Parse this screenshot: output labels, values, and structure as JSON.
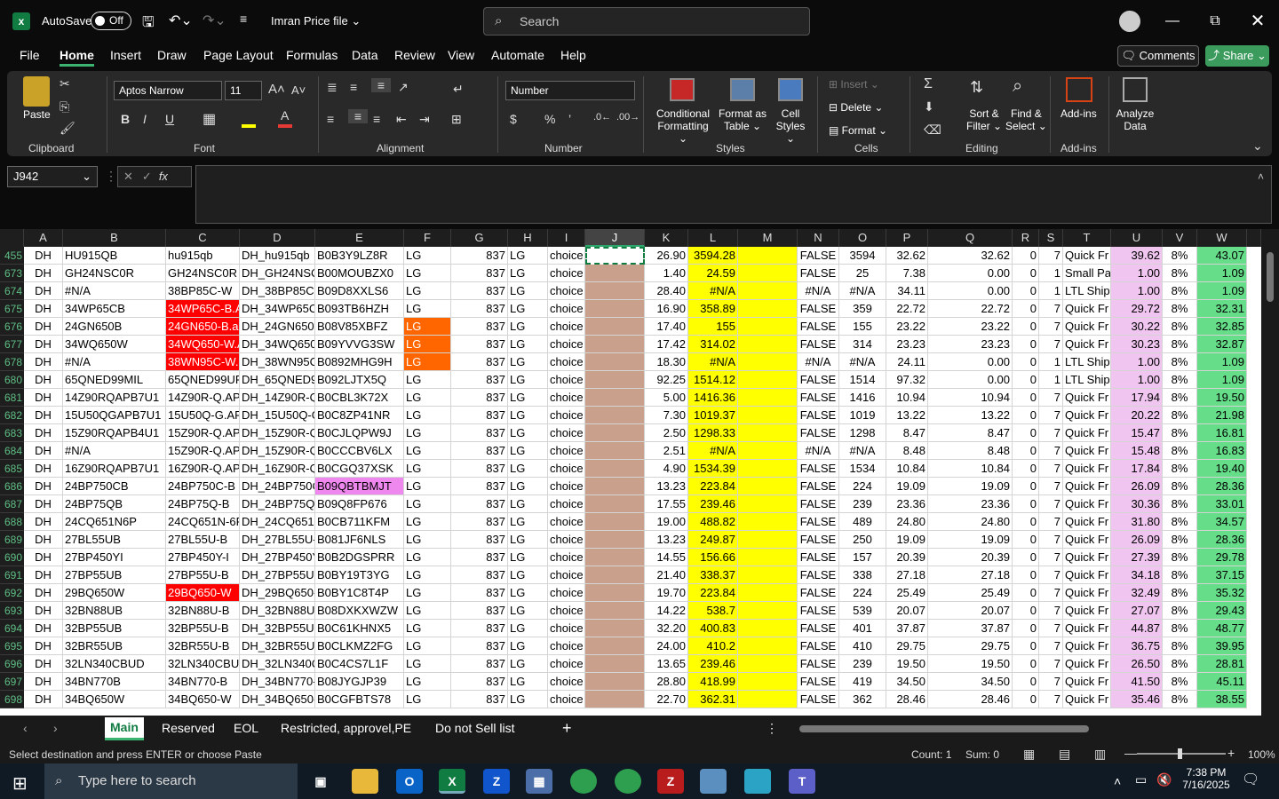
{
  "titlebar": {
    "autosave_label": "AutoSave",
    "toggle_state": "Off",
    "file_name": "Imran Price file",
    "search_placeholder": "Search"
  },
  "menu": [
    "File",
    "Home",
    "Insert",
    "Draw",
    "Page Layout",
    "Formulas",
    "Data",
    "Review",
    "View",
    "Automate",
    "Help"
  ],
  "menu_active": "Home",
  "comments_label": "Comments",
  "share_label": "Share",
  "ribbon": {
    "paste": "Paste",
    "clipboard": "Clipboard",
    "font_name": "Aptos Narrow",
    "font_size": "11",
    "font": "Font",
    "alignment": "Alignment",
    "number_format": "Number",
    "number": "Number",
    "cond_fmt_1": "Conditional",
    "cond_fmt_2": "Formatting",
    "fmt_table_1": "Format as",
    "fmt_table_2": "Table",
    "cell_styles_1": "Cell",
    "cell_styles_2": "Styles",
    "styles": "Styles",
    "insert": "Insert",
    "delete": "Delete",
    "format": "Format",
    "cells": "Cells",
    "sort_1": "Sort &",
    "sort_2": "Filter",
    "find_1": "Find &",
    "find_2": "Select",
    "editing": "Editing",
    "addins": "Add-ins",
    "analyze_1": "Analyze",
    "analyze_2": "Data",
    "bold": "B",
    "italic": "I",
    "underline": "U"
  },
  "name_box": "J942",
  "fx": "fx",
  "columns": [
    "A",
    "B",
    "C",
    "D",
    "E",
    "F",
    "G",
    "H",
    "I",
    "J",
    "K",
    "L",
    "M",
    "N",
    "O",
    "P",
    "Q",
    "R",
    "S",
    "T",
    "U",
    "V",
    "W"
  ],
  "rows": [
    {
      "n": "455",
      "A": "DH",
      "B": "HU915QB",
      "C": "hu915qb",
      "D": "DH_hu915qb",
      "E": "B0B3Y9LZ8R",
      "F": "LG",
      "G": "837",
      "H": "LG",
      "I": "choice",
      "K": "26.90",
      "L": "3594.28",
      "N": "FALSE",
      "O": "3594",
      "P": "32.62",
      "Q": "32.62",
      "R": "0",
      "S": "7",
      "T": "Quick Fr",
      "U": "39.62",
      "V": "8%",
      "W": "43.07"
    },
    {
      "n": "673",
      "A": "DH",
      "B": "GH24NSC0R",
      "C": "GH24NSC0R",
      "D": "DH_GH24NSC",
      "E": "B00MOUBZX0",
      "F": "LG",
      "G": "837",
      "H": "LG",
      "I": "choice",
      "K": "1.40",
      "L": "24.59",
      "N": "FALSE",
      "O": "25",
      "P": "7.38",
      "Q": "0.00",
      "R": "0",
      "S": "1",
      "T": "Small Pa",
      "U": "1.00",
      "V": "8%",
      "W": "1.09"
    },
    {
      "n": "674",
      "A": "DH",
      "B": "#N/A",
      "C": "38BP85C-W",
      "D": "DH_38BP85C-",
      "E": "B09D8XXLS6",
      "F": "LG",
      "G": "837",
      "H": "LG",
      "I": "choice",
      "K": "28.40",
      "L": "#N/A",
      "N": "#N/A",
      "O": "#N/A",
      "P": "34.11",
      "Q": "0.00",
      "R": "0",
      "S": "1",
      "T": "LTL Ship",
      "U": "1.00",
      "V": "8%",
      "W": "1.09"
    },
    {
      "n": "675",
      "A": "DH",
      "B": "34WP65CB",
      "C": "34WP65C-B.A",
      "D": "DH_34WP65C-",
      "E": "B093TB6HZH",
      "F": "LG",
      "G": "837",
      "H": "LG",
      "I": "choice",
      "K": "16.90",
      "L": "358.89",
      "N": "FALSE",
      "O": "359",
      "P": "22.72",
      "Q": "22.72",
      "R": "0",
      "S": "7",
      "T": "Quick Fr",
      "U": "29.72",
      "V": "8%",
      "W": "32.31"
    },
    {
      "n": "676",
      "A": "DH",
      "B": "24GN650B",
      "C": "24GN650-B.a",
      "D": "DH_24GN650-",
      "E": "B08V85XBFZ",
      "F": "LG",
      "G": "837",
      "H": "LG",
      "I": "choice",
      "K": "17.40",
      "L": "155",
      "N": "FALSE",
      "O": "155",
      "P": "23.22",
      "Q": "23.22",
      "R": "0",
      "S": "7",
      "T": "Quick Fr",
      "U": "30.22",
      "V": "8%",
      "W": "32.85"
    },
    {
      "n": "677",
      "A": "DH",
      "B": "34WQ650W",
      "C": "34WQ650-W.A",
      "D": "DH_34WQ650",
      "E": "B09YVVG3SW",
      "F": "LG",
      "G": "837",
      "H": "LG",
      "I": "choice",
      "K": "17.42",
      "L": "314.02",
      "N": "FALSE",
      "O": "314",
      "P": "23.23",
      "Q": "23.23",
      "R": "0",
      "S": "7",
      "T": "Quick Fr",
      "U": "30.23",
      "V": "8%",
      "W": "32.87"
    },
    {
      "n": "678",
      "A": "DH",
      "B": "#N/A",
      "C": "38WN95C-W.",
      "D": "DH_38WN95C",
      "E": "B0892MHG9H",
      "F": "LG",
      "G": "837",
      "H": "LG",
      "I": "choice",
      "K": "18.30",
      "L": "#N/A",
      "N": "#N/A",
      "O": "#N/A",
      "P": "24.11",
      "Q": "0.00",
      "R": "0",
      "S": "1",
      "T": "LTL Ship",
      "U": "1.00",
      "V": "8%",
      "W": "1.09"
    },
    {
      "n": "680",
      "A": "DH",
      "B": "65QNED99MIL",
      "C": "65QNED99UP",
      "D": "DH_65QNED9",
      "E": "B092LJTX5Q",
      "F": "LG",
      "G": "837",
      "H": "LG",
      "I": "choice",
      "K": "92.25",
      "L": "1514.12",
      "N": "FALSE",
      "O": "1514",
      "P": "97.32",
      "Q": "0.00",
      "R": "0",
      "S": "1",
      "T": "LTL Ship",
      "U": "1.00",
      "V": "8%",
      "W": "1.09"
    },
    {
      "n": "681",
      "A": "DH",
      "B": "14Z90RQAPB7U1",
      "C": "14Z90R-Q.AP",
      "D": "DH_14Z90R-Q",
      "E": "B0CBL3K72X",
      "F": "LG",
      "G": "837",
      "H": "LG",
      "I": "choice",
      "K": "5.00",
      "L": "1416.36",
      "N": "FALSE",
      "O": "1416",
      "P": "10.94",
      "Q": "10.94",
      "R": "0",
      "S": "7",
      "T": "Quick Fr",
      "U": "17.94",
      "V": "8%",
      "W": "19.50"
    },
    {
      "n": "682",
      "A": "DH",
      "B": "15U50QGAPB7U1",
      "C": "15U50Q-G.AP",
      "D": "DH_15U50Q-G",
      "E": "B0C8ZP41NR",
      "F": "LG",
      "G": "837",
      "H": "LG",
      "I": "choice",
      "K": "7.30",
      "L": "1019.37",
      "N": "FALSE",
      "O": "1019",
      "P": "13.22",
      "Q": "13.22",
      "R": "0",
      "S": "7",
      "T": "Quick Fr",
      "U": "20.22",
      "V": "8%",
      "W": "21.98"
    },
    {
      "n": "683",
      "A": "DH",
      "B": "15Z90RQAPB4U1",
      "C": "15Z90R-Q.AP",
      "D": "DH_15Z90R-Q",
      "E": "B0CJLQPW9J",
      "F": "LG",
      "G": "837",
      "H": "LG",
      "I": "choice",
      "K": "2.50",
      "L": "1298.33",
      "N": "FALSE",
      "O": "1298",
      "P": "8.47",
      "Q": "8.47",
      "R": "0",
      "S": "7",
      "T": "Quick Fr",
      "U": "15.47",
      "V": "8%",
      "W": "16.81"
    },
    {
      "n": "684",
      "A": "DH",
      "B": "#N/A",
      "C": "15Z90R-Q.AP",
      "D": "DH_15Z90R-Q",
      "E": "B0CCCBV6LX",
      "F": "LG",
      "G": "837",
      "H": "LG",
      "I": "choice",
      "K": "2.51",
      "L": "#N/A",
      "N": "#N/A",
      "O": "#N/A",
      "P": "8.48",
      "Q": "8.48",
      "R": "0",
      "S": "7",
      "T": "Quick Fr",
      "U": "15.48",
      "V": "8%",
      "W": "16.83"
    },
    {
      "n": "685",
      "A": "DH",
      "B": "16Z90RQAPB7U1",
      "C": "16Z90R-Q.AP",
      "D": "DH_16Z90R-Q",
      "E": "B0CGQ37XSK",
      "F": "LG",
      "G": "837",
      "H": "LG",
      "I": "choice",
      "K": "4.90",
      "L": "1534.39",
      "N": "FALSE",
      "O": "1534",
      "P": "10.84",
      "Q": "10.84",
      "R": "0",
      "S": "7",
      "T": "Quick Fr",
      "U": "17.84",
      "V": "8%",
      "W": "19.40"
    },
    {
      "n": "686",
      "A": "DH",
      "B": "24BP750CB",
      "C": "24BP750C-B",
      "D": "DH_24BP750C",
      "E": "B09QBTBMJT",
      "F": "LG",
      "G": "837",
      "H": "LG",
      "I": "choice",
      "K": "13.23",
      "L": "223.84",
      "N": "FALSE",
      "O": "224",
      "P": "19.09",
      "Q": "19.09",
      "R": "0",
      "S": "7",
      "T": "Quick Fr",
      "U": "26.09",
      "V": "8%",
      "W": "28.36"
    },
    {
      "n": "687",
      "A": "DH",
      "B": "24BP75QB",
      "C": "24BP75Q-B",
      "D": "DH_24BP75Q-",
      "E": "B09Q8FP676",
      "F": "LG",
      "G": "837",
      "H": "LG",
      "I": "choice",
      "K": "17.55",
      "L": "239.46",
      "N": "FALSE",
      "O": "239",
      "P": "23.36",
      "Q": "23.36",
      "R": "0",
      "S": "7",
      "T": "Quick Fr",
      "U": "30.36",
      "V": "8%",
      "W": "33.01"
    },
    {
      "n": "688",
      "A": "DH",
      "B": "24CQ651N6P",
      "C": "24CQ651N-6P",
      "D": "DH_24CQ651N",
      "E": "B0CB711KFM",
      "F": "LG",
      "G": "837",
      "H": "LG",
      "I": "choice",
      "K": "19.00",
      "L": "488.82",
      "N": "FALSE",
      "O": "489",
      "P": "24.80",
      "Q": "24.80",
      "R": "0",
      "S": "7",
      "T": "Quick Fr",
      "U": "31.80",
      "V": "8%",
      "W": "34.57"
    },
    {
      "n": "689",
      "A": "DH",
      "B": "27BL55UB",
      "C": "27BL55U-B",
      "D": "DH_27BL55U-",
      "E": "B081JF6NLS",
      "F": "LG",
      "G": "837",
      "H": "LG",
      "I": "choice",
      "K": "13.23",
      "L": "249.87",
      "N": "FALSE",
      "O": "250",
      "P": "19.09",
      "Q": "19.09",
      "R": "0",
      "S": "7",
      "T": "Quick Fr",
      "U": "26.09",
      "V": "8%",
      "W": "28.36"
    },
    {
      "n": "690",
      "A": "DH",
      "B": "27BP450YI",
      "C": "27BP450Y-I",
      "D": "DH_27BP450Y",
      "E": "B0B2DGSPRR",
      "F": "LG",
      "G": "837",
      "H": "LG",
      "I": "choice",
      "K": "14.55",
      "L": "156.66",
      "N": "FALSE",
      "O": "157",
      "P": "20.39",
      "Q": "20.39",
      "R": "0",
      "S": "7",
      "T": "Quick Fr",
      "U": "27.39",
      "V": "8%",
      "W": "29.78"
    },
    {
      "n": "691",
      "A": "DH",
      "B": "27BP55UB",
      "C": "27BP55U-B",
      "D": "DH_27BP55U-",
      "E": "B0BY19T3YG",
      "F": "LG",
      "G": "837",
      "H": "LG",
      "I": "choice",
      "K": "21.40",
      "L": "338.37",
      "N": "FALSE",
      "O": "338",
      "P": "27.18",
      "Q": "27.18",
      "R": "0",
      "S": "7",
      "T": "Quick Fr",
      "U": "34.18",
      "V": "8%",
      "W": "37.15"
    },
    {
      "n": "692",
      "A": "DH",
      "B": "29BQ650W",
      "C": "29BQ650-W",
      "D": "DH_29BQ650-",
      "E": "B0BY1C8T4P",
      "F": "LG",
      "G": "837",
      "H": "LG",
      "I": "choice",
      "K": "19.70",
      "L": "223.84",
      "N": "FALSE",
      "O": "224",
      "P": "25.49",
      "Q": "25.49",
      "R": "0",
      "S": "7",
      "T": "Quick Fr",
      "U": "32.49",
      "V": "8%",
      "W": "35.32"
    },
    {
      "n": "693",
      "A": "DH",
      "B": "32BN88UB",
      "C": "32BN88U-B",
      "D": "DH_32BN88U-",
      "E": "B08DXKXWZW",
      "F": "LG",
      "G": "837",
      "H": "LG",
      "I": "choice",
      "K": "14.22",
      "L": "538.7",
      "N": "FALSE",
      "O": "539",
      "P": "20.07",
      "Q": "20.07",
      "R": "0",
      "S": "7",
      "T": "Quick Fr",
      "U": "27.07",
      "V": "8%",
      "W": "29.43"
    },
    {
      "n": "694",
      "A": "DH",
      "B": "32BP55UB",
      "C": "32BP55U-B",
      "D": "DH_32BP55U-",
      "E": "B0C61KHNX5",
      "F": "LG",
      "G": "837",
      "H": "LG",
      "I": "choice",
      "K": "32.20",
      "L": "400.83",
      "N": "FALSE",
      "O": "401",
      "P": "37.87",
      "Q": "37.87",
      "R": "0",
      "S": "7",
      "T": "Quick Fr",
      "U": "44.87",
      "V": "8%",
      "W": "48.77"
    },
    {
      "n": "695",
      "A": "DH",
      "B": "32BR55UB",
      "C": "32BR55U-B",
      "D": "DH_32BR55U-",
      "E": "B0CLKMZ2FG",
      "F": "LG",
      "G": "837",
      "H": "LG",
      "I": "choice",
      "K": "24.00",
      "L": "410.2",
      "N": "FALSE",
      "O": "410",
      "P": "29.75",
      "Q": "29.75",
      "R": "0",
      "S": "7",
      "T": "Quick Fr",
      "U": "36.75",
      "V": "8%",
      "W": "39.95"
    },
    {
      "n": "696",
      "A": "DH",
      "B": "32LN340CBUD",
      "C": "32LN340CBU",
      "D": "DH_32LN340C",
      "E": "B0C4CS7L1F",
      "F": "LG",
      "G": "837",
      "H": "LG",
      "I": "choice",
      "K": "13.65",
      "L": "239.46",
      "N": "FALSE",
      "O": "239",
      "P": "19.50",
      "Q": "19.50",
      "R": "0",
      "S": "7",
      "T": "Quick Fr",
      "U": "26.50",
      "V": "8%",
      "W": "28.81"
    },
    {
      "n": "697",
      "A": "DH",
      "B": "34BN770B",
      "C": "34BN770-B",
      "D": "DH_34BN770-",
      "E": "B08JYGJP39",
      "F": "LG",
      "G": "837",
      "H": "LG",
      "I": "choice",
      "K": "28.80",
      "L": "418.99",
      "N": "FALSE",
      "O": "419",
      "P": "34.50",
      "Q": "34.50",
      "R": "0",
      "S": "7",
      "T": "Quick Fr",
      "U": "41.50",
      "V": "8%",
      "W": "45.11"
    },
    {
      "n": "698",
      "A": "DH",
      "B": "34BQ650W",
      "C": "34BQ650-W",
      "D": "DH_34BQ650-",
      "E": "B0CGFBTS78",
      "F": "LG",
      "G": "837",
      "H": "LG",
      "I": "choice",
      "K": "22.70",
      "L": "362.31",
      "N": "FALSE",
      "O": "362",
      "P": "28.46",
      "Q": "28.46",
      "R": "0",
      "S": "7",
      "T": "Quick Fr",
      "U": "35.46",
      "V": "8%",
      "W": "38.55"
    }
  ],
  "red_c_rows": [
    "675",
    "676",
    "677",
    "678",
    "692"
  ],
  "orange_f_rows": [
    "676",
    "677",
    "678"
  ],
  "pink_e_rows": [
    "686"
  ],
  "colors": {
    "yellow": "#ffff00",
    "red": "#ff0000",
    "orange": "#ff6600",
    "pink": "#ee88ee",
    "u_col": "#f0c6f0",
    "w_col": "#66dd88",
    "j_col": "#c8a08c",
    "accent": "#107c41"
  },
  "sheet_tabs": [
    "Main",
    "Reserved",
    "EOL",
    "Restricted, approvel,PE",
    "Do not Sell list"
  ],
  "active_tab": "Main",
  "status": {
    "message": "Select destination and press ENTER or choose Paste",
    "count": "Count: 1",
    "sum": "Sum: 0",
    "zoom": "100%"
  },
  "taskbar": {
    "search_placeholder": "Type here to search",
    "time": "7:38 PM",
    "date": "7/16/2025"
  }
}
